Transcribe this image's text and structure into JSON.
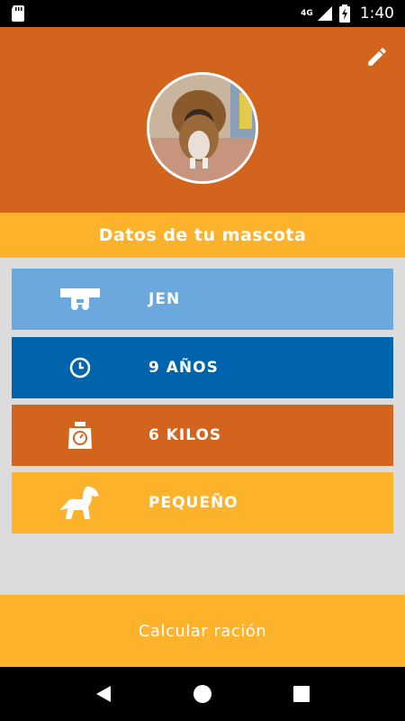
{
  "status_bar": {
    "network": "4G",
    "time": "1:40"
  },
  "header": {
    "edit_icon": "pencil-icon",
    "avatar_description": "pet-photo"
  },
  "section_title": "Datos de tu mascota",
  "cards": [
    {
      "icon": "collar-icon",
      "text": "JEN",
      "color": "#6aa8de"
    },
    {
      "icon": "clock-icon",
      "text": "9 AÑOS",
      "color": "#0064ac"
    },
    {
      "icon": "scale-icon",
      "text": "6 KILOS",
      "color": "#d2641e"
    },
    {
      "icon": "dog-icon",
      "text": "PEQUEÑO",
      "color": "#fdb22b"
    }
  ],
  "action_button": "Calcular ración",
  "colors": {
    "header": "#d2641e",
    "accent": "#fdb22b",
    "background": "#dcdcdc"
  }
}
